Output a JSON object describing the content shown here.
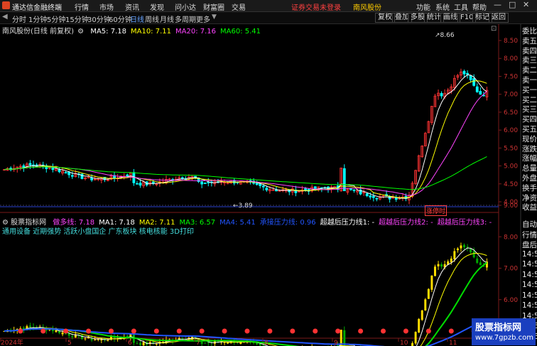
{
  "app": {
    "title": "通达信金融终端",
    "menu": [
      "行情",
      "市场",
      "资讯",
      "发现",
      "问小达",
      "财富圈",
      "交易"
    ],
    "warning": "证券交易未登录",
    "stock_name": "南风股份",
    "right_menu": [
      "功能",
      "系统",
      "工具",
      "帮助"
    ]
  },
  "periods": [
    "分时",
    "1分钟",
    "5分钟",
    "15分钟",
    "30分钟",
    "60分钟",
    "日线",
    "周线",
    "月线",
    "多周期",
    "更多"
  ],
  "active_period": "日线",
  "toolbar": [
    "复权",
    "叠加",
    "多股",
    "统计",
    "画线",
    "F10",
    "标记",
    "返回"
  ],
  "main_chart": {
    "title": "南风股份(日线 前复权)",
    "ma": [
      {
        "label": "MA5: 7.18",
        "color": "#ffffff"
      },
      {
        "label": "MA10: 7.11",
        "color": "#ffff00"
      },
      {
        "label": "MA20: 7.16",
        "color": "#ff44ff"
      },
      {
        "label": "MA60: 5.41",
        "color": "#00ff00"
      }
    ],
    "high_label": "8.66",
    "low_label": "3.89",
    "tag": "涨停时",
    "price_ticks": [
      "8.50",
      "8.00",
      "7.50",
      "7.00",
      "6.50",
      "6.00",
      "5.50",
      "5.00",
      "4.50",
      "4.00"
    ]
  },
  "indicator": {
    "name": "股票指标网",
    "lines": [
      {
        "label": "做多线: 7.18",
        "color": "#ff44ff"
      },
      {
        "label": "MA1: 7.18",
        "color": "#ffffff"
      },
      {
        "label": "MA2: 7.11",
        "color": "#ffff00"
      },
      {
        "label": "MA3: 6.57",
        "color": "#00ff00"
      },
      {
        "label": "MA4: 5.41",
        "color": "#2255ff"
      },
      {
        "label": "承接压力线: 0.96",
        "color": "#2255ff"
      },
      {
        "label": "超越后压力线1: -",
        "color": "#ffffff"
      },
      {
        "label": "超越后压力线2: -",
        "color": "#ff44ff"
      },
      {
        "label": "超越后压力线3: -",
        "color": "#ff44ff"
      }
    ],
    "concepts": "通用设备 近期强势 活跃小盘国企 广东板块 核电核能 3D打印",
    "ticks": [
      "9.00",
      "8.00",
      "7.00",
      "6.00",
      "5.00"
    ]
  },
  "x_axis": [
    "2024年",
    "5",
    "6",
    "7",
    "8",
    "9",
    "10",
    "11"
  ],
  "right_panel": {
    "top": [
      "委比",
      "卖五",
      "卖四",
      "卖三",
      "卖二",
      "卖一",
      "买一",
      "买二",
      "买三",
      "买四",
      "买五",
      "现价",
      "涨跌",
      "涨幅",
      "总量",
      "外盘",
      "换手",
      "净资",
      "收益"
    ],
    "bottom": [
      "自动",
      "行情",
      "盘后",
      "14:50",
      "14:50",
      "14:50",
      "14:50",
      "14:50",
      "14:50",
      "14:50",
      "14:50",
      "14:50"
    ]
  },
  "watermark": {
    "line1": "股票指标网",
    "line2": "www.7gpzb.com"
  },
  "colors": {
    "up": "#ff3333",
    "down": "#00ffff",
    "bg": "#000000",
    "ma5": "#ffffff",
    "ma10": "#ffff00",
    "ma20": "#ff44ff",
    "ma60": "#00ff00"
  }
}
